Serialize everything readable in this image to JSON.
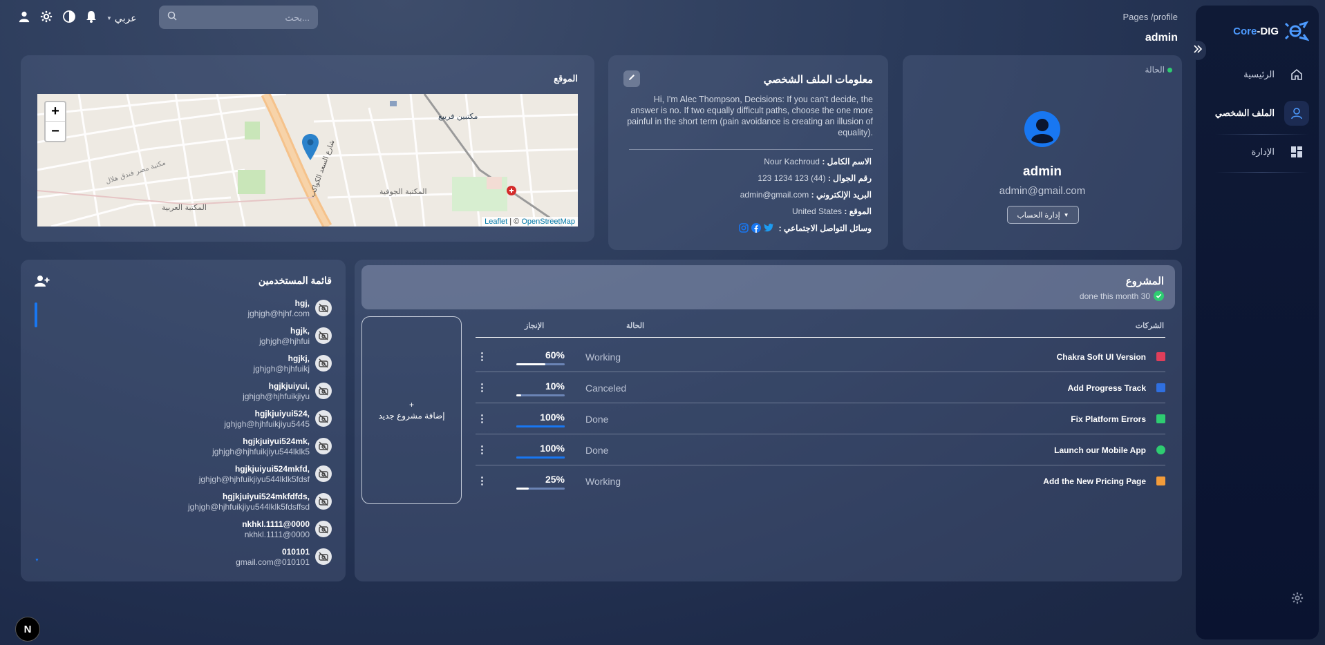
{
  "brand": {
    "core": "Core",
    "suffix": "-DIG"
  },
  "sidebar": {
    "items": [
      {
        "label": "الرئيسية",
        "icon": "home-icon"
      },
      {
        "label": "الملف الشخصي",
        "icon": "person-icon",
        "active": true
      },
      {
        "label": "الإدارة",
        "icon": "dashboard-icon"
      }
    ]
  },
  "topbar": {
    "breadcrumb": "Pages /profile",
    "title": "admin",
    "search_placeholder": "بحث...",
    "language": "عربي"
  },
  "profile": {
    "status_label": "الحالة",
    "name": "admin",
    "email": "admin@gmail.com",
    "manage_label": "إدارة الحساب"
  },
  "info": {
    "title": "معلومات الملف الشخصي",
    "bio": "Hi, I'm Alec Thompson, Decisions: If you can't decide, the answer is no. If two equally difficult paths, choose the one more painful in the short term (pain avoidance is creating an illusion of equality).",
    "rows": [
      {
        "label": "الاسم الكامل :",
        "value": "Nour Kachroud"
      },
      {
        "label": "رقم الجوال :",
        "value": "(44) 123 1234 123"
      },
      {
        "label": "البريد الإلكتروني :",
        "value": "admin@gmail.com"
      },
      {
        "label": "الموقع :",
        "value": "United States"
      },
      {
        "label": "وسائل التواصل الاجتماعي :",
        "value": ""
      }
    ]
  },
  "map": {
    "title": "الموقع",
    "labels": [
      "مكتبين فريبع",
      "المكتبة الجوفية",
      "المكتبة العربية",
      "شارع السعد الكواكب",
      "مكتبة مصر فندق هلال"
    ],
    "attribution_leaflet": "Leaflet",
    "attribution_sep": " | © ",
    "attribution_osm": "OpenStreetMap"
  },
  "users": {
    "title": "قائمة المستخدمين",
    "list": [
      {
        "name": "hgj,",
        "email": "jghjgh@hjhf.com"
      },
      {
        "name": "hgjk,",
        "email": "jghjgh@hjhfui"
      },
      {
        "name": "hgjkj,",
        "email": "jghjgh@hjhfuikj"
      },
      {
        "name": "hgjkjuiyui,",
        "email": "jghjgh@hjhfuikjiyu"
      },
      {
        "name": "hgjkjuiyui524,",
        "email": "jghjgh@hjhfuikjiyu5445"
      },
      {
        "name": "hgjkjuiyui524mk,",
        "email": "jghjgh@hjhfuikjiyu544lklk5"
      },
      {
        "name": "hgjkjuiyui524mkfd,",
        "email": "jghjgh@hjhfuikjiyu544lklk5fdsf"
      },
      {
        "name": "hgjkjuiyui524mkfdfds,",
        "email": "jghjgh@hjhfuikjiyu544lklk5fdsffsd"
      },
      {
        "name": "nkhkl.1111@0000",
        "email": "nkhkl.1111@0000"
      },
      {
        "name": "010101",
        "email": "gmail.com@010101"
      }
    ]
  },
  "projects": {
    "title": "المشروع",
    "subtitle": "done this month 30",
    "new_label": "إضافة مشروع جديد",
    "new_plus": "+",
    "headers": {
      "company": "الشركات",
      "status": "الحالة",
      "progress": "الإنجاز"
    },
    "rows": [
      {
        "name": "Chakra Soft UI Version",
        "status": "Working",
        "progress_label": "60%",
        "progress": 0.6,
        "color": "#e03e5a",
        "round": false
      },
      {
        "name": "Add Progress Track",
        "status": "Canceled",
        "progress_label": "10%",
        "progress": 0.1,
        "color": "#2f6fe0",
        "round": false
      },
      {
        "name": "Fix Platform Errors",
        "status": "Done",
        "progress_label": "100%",
        "progress": 1.0,
        "color": "#2ecc71",
        "round": false
      },
      {
        "name": "Launch our Mobile App",
        "status": "Done",
        "progress_label": "100%",
        "progress": 1.0,
        "color": "#2ecc71",
        "round": true
      },
      {
        "name": "Add the New Pricing Page",
        "status": "Working",
        "progress_label": "25%",
        "progress": 0.25,
        "color": "#f39c3a",
        "round": false
      }
    ]
  },
  "colors": {
    "accent": "#1877f2",
    "success": "#2ecc71"
  },
  "next_badge": "N"
}
